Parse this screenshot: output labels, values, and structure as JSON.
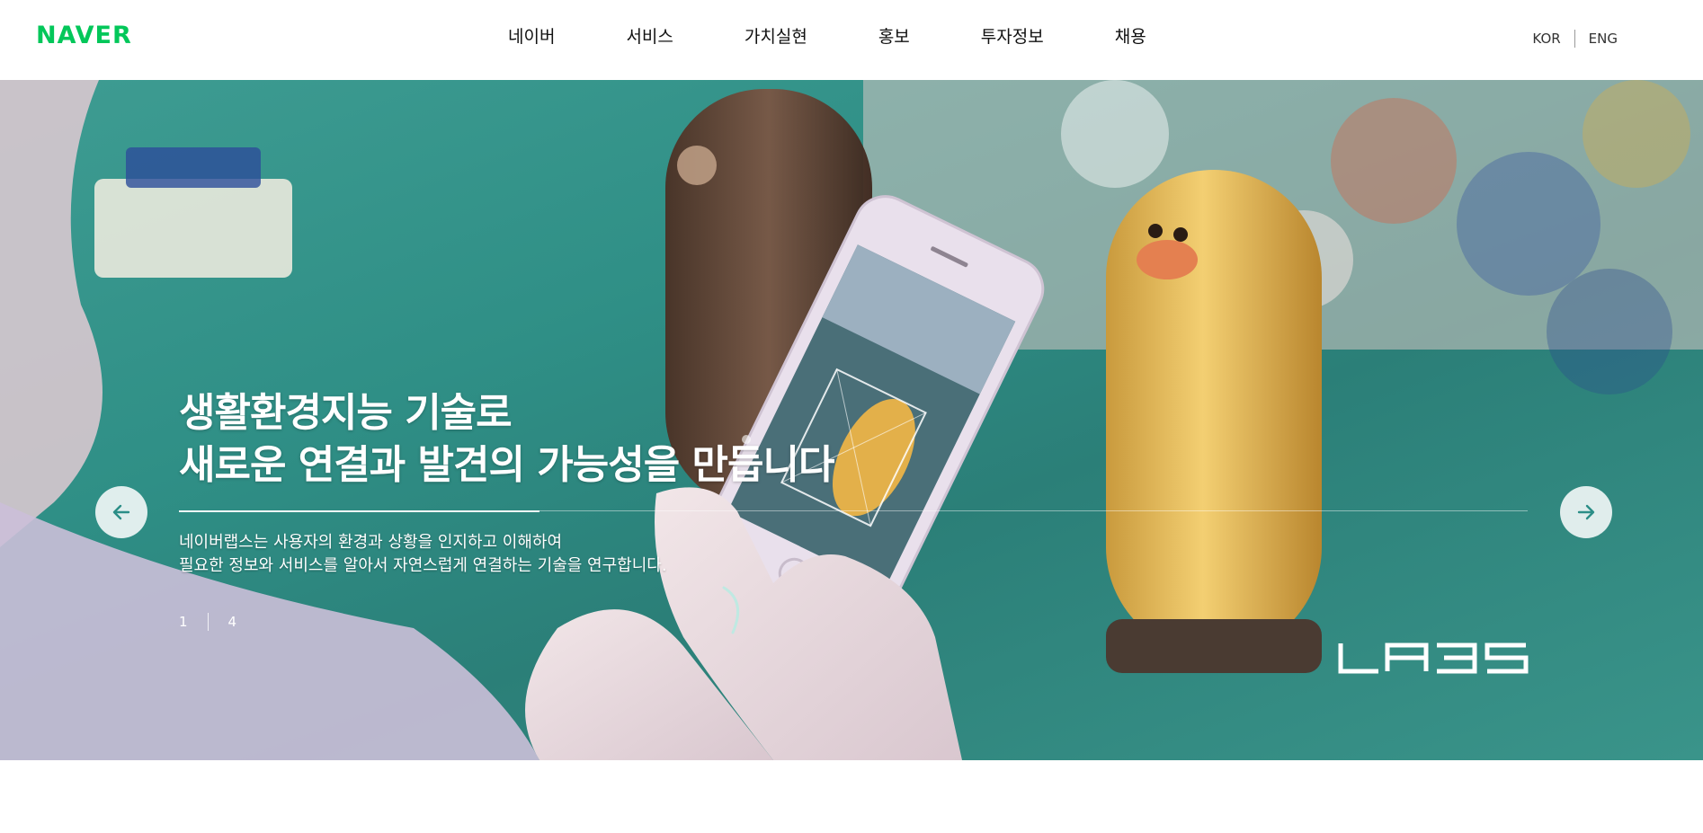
{
  "header": {
    "logo": "NAVER",
    "nav": [
      "네이버",
      "서비스",
      "가치실현",
      "홍보",
      "투자정보",
      "채용"
    ],
    "lang": {
      "kor": "KOR",
      "eng": "ENG"
    }
  },
  "hero": {
    "headline_line1": "생활환경지능 기술로",
    "headline_line2": "새로운 연결과 발견의 가능성을 만듭니다",
    "desc_line1": "네이버랩스는 사용자의 환경과 상황을 인지하고 이해하여",
    "desc_line2": "필요한 정보와 서비스를 알아서 자연스럽게 연결하는 기술을 연구합니다.",
    "pager": {
      "current": "1",
      "total": "4"
    },
    "prev_icon": "arrow-left-icon",
    "next_icon": "arrow-right-icon",
    "brand_mark": "LABS"
  },
  "colors": {
    "brand_green": "#03c75a",
    "teal": "#2f8f86"
  }
}
